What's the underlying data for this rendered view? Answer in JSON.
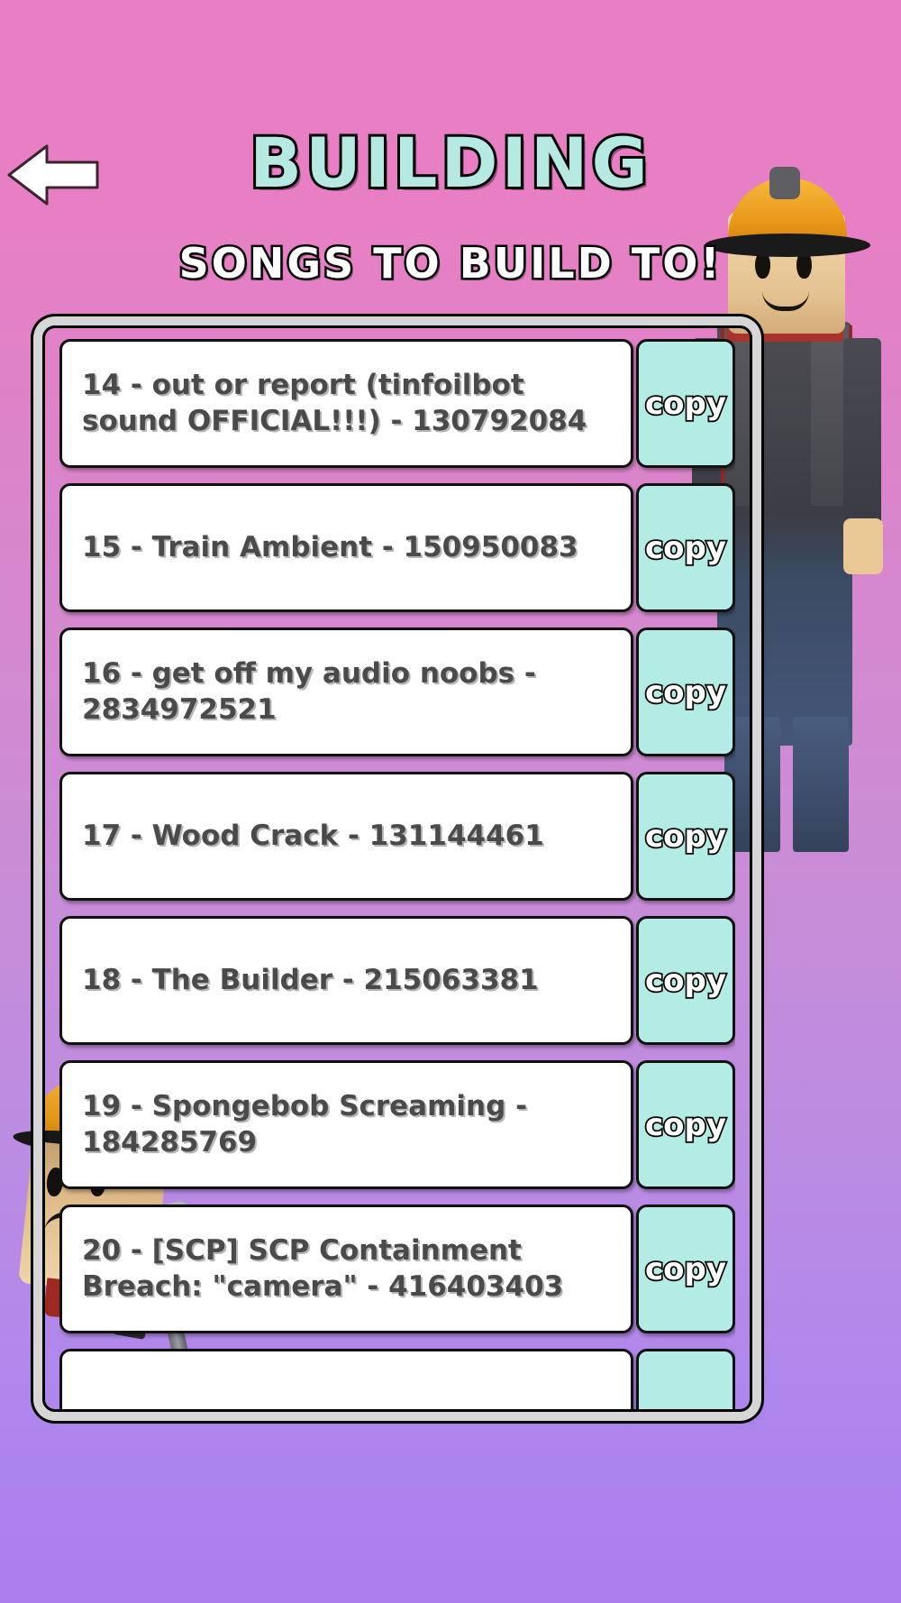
{
  "header": {
    "back_icon": "back-arrow-icon",
    "title": "BUILDING",
    "subtitle": "SONGS TO BUILD TO!"
  },
  "colors": {
    "background_top": "#e87fc4",
    "background_bottom": "#a97fee",
    "title_fill": "#b7e9e3",
    "subtitle_fill": "#ffffff",
    "copy_button_bg": "#b2ece5",
    "row_bg": "#ffffff",
    "row_text": "#4a4a4a",
    "frame_border": "#d6d6d6"
  },
  "list": {
    "copy_label": "copy",
    "rows": [
      {
        "text": "14 -  out or report (tinfoilbot sound OFFICIAL!!!) - 130792084",
        "copy_label": "copy"
      },
      {
        "text": "15 -  Train Ambient - 150950083",
        "copy_label": "copy"
      },
      {
        "text": "16 -  get off my audio noobs - 2834972521",
        "copy_label": "copy"
      },
      {
        "text": "17 -  Wood Crack - 131144461",
        "copy_label": "copy"
      },
      {
        "text": "18 -  The Builder - 215063381",
        "copy_label": "copy"
      },
      {
        "text": "19 -  Spongebob Screaming - 184285769",
        "copy_label": "copy"
      },
      {
        "text": "20 -  [SCP] SCP Containment Breach: \"camera\" - 416403403",
        "copy_label": "copy"
      },
      {
        "text": "",
        "copy_label": ""
      }
    ]
  }
}
